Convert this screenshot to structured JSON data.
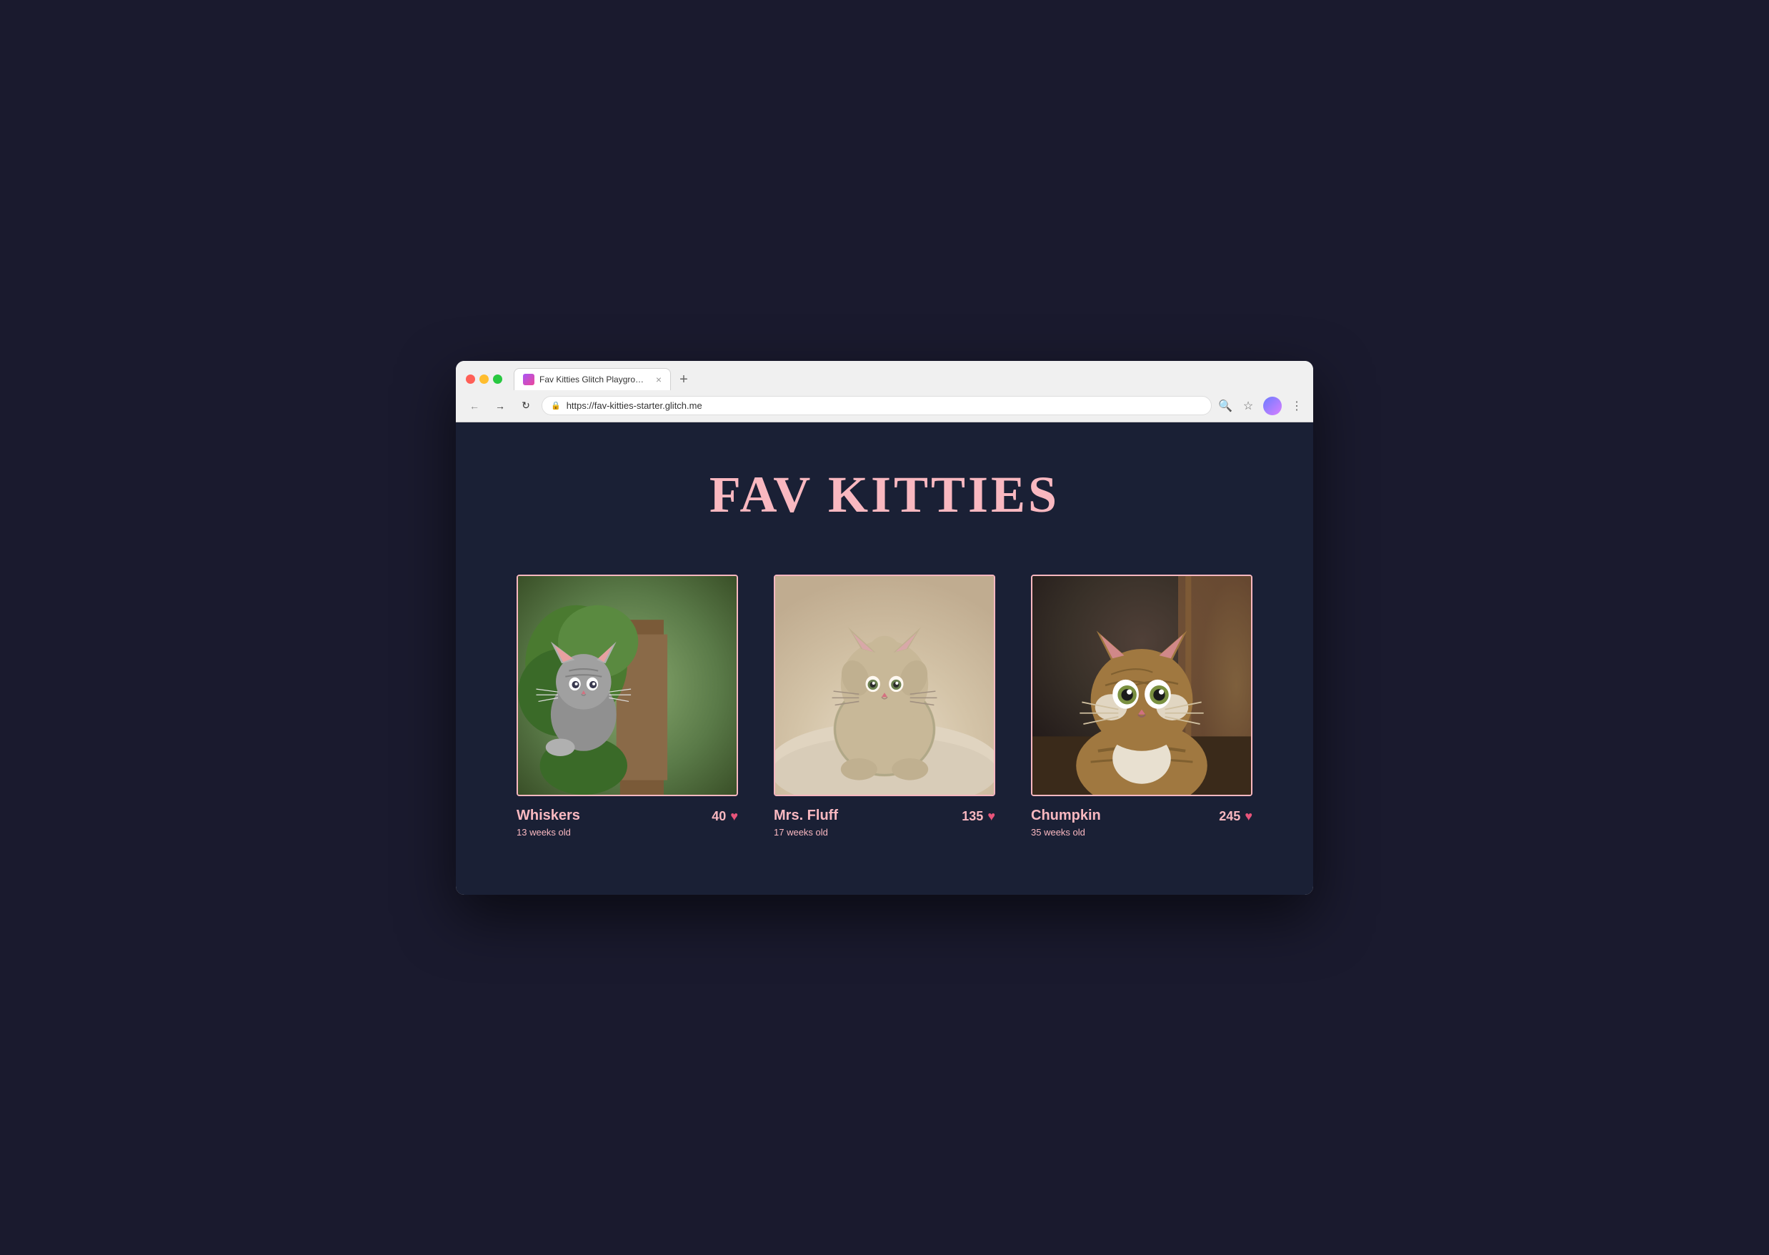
{
  "browser": {
    "tab_title": "Fav Kitties Glitch Playground",
    "tab_close": "×",
    "tab_new": "+",
    "url": "https://fav-kitties-starter.glitch.me",
    "nav": {
      "back": "←",
      "forward": "→",
      "refresh": "↻"
    },
    "toolbar_icons": {
      "search": "🔍",
      "star": "☆",
      "more": "⋮"
    }
  },
  "site": {
    "title": "FAV KITTIES",
    "cats": [
      {
        "name": "Whiskers",
        "age": "13 weeks old",
        "votes": "40",
        "heart": "♥",
        "theme": "whiskers"
      },
      {
        "name": "Mrs. Fluff",
        "age": "17 weeks old",
        "votes": "135",
        "heart": "♥",
        "theme": "mrs-fluff"
      },
      {
        "name": "Chumpkin",
        "age": "35 weeks old",
        "votes": "245",
        "heart": "♥",
        "theme": "chumpkin"
      }
    ]
  },
  "colors": {
    "bg_dark": "#1a2035",
    "pink_accent": "#f9b8c0",
    "heart_red": "#e8547a",
    "browser_bg": "#f0f0f0"
  }
}
